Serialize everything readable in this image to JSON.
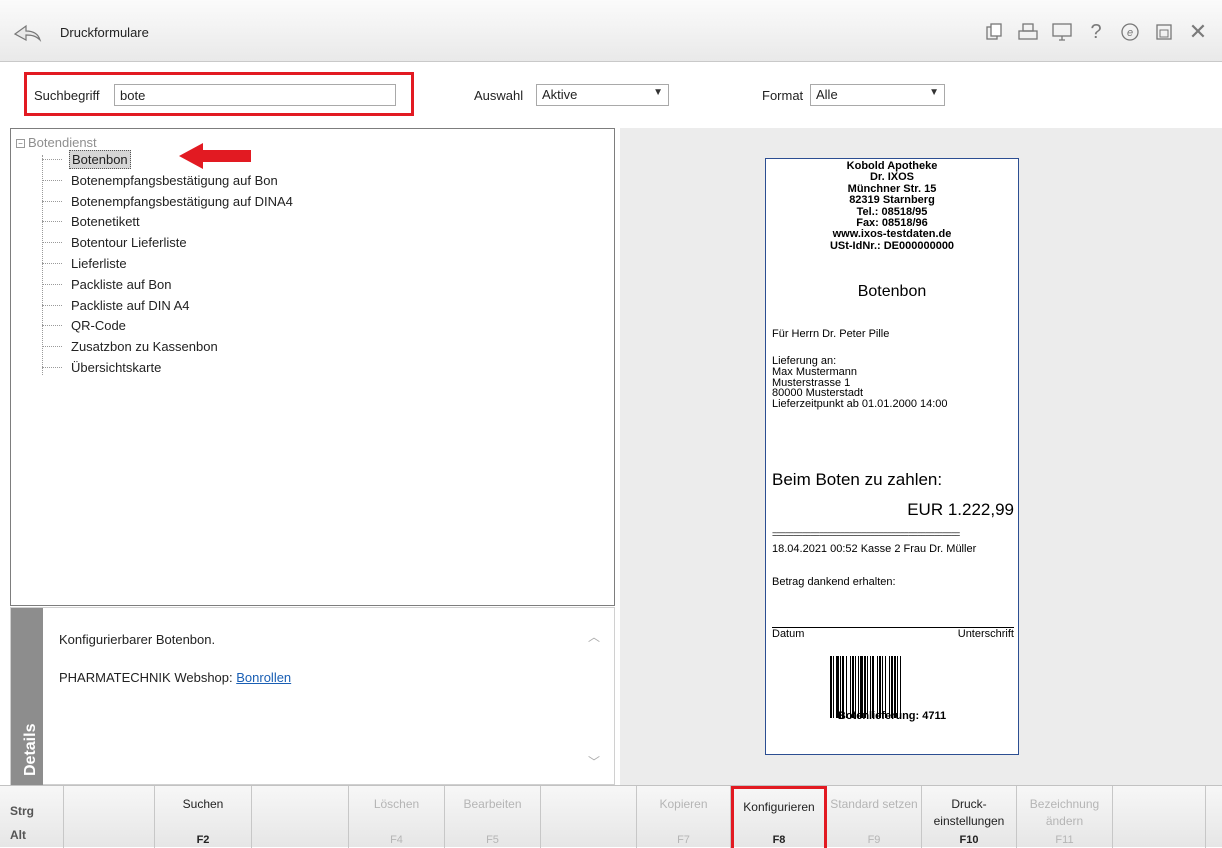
{
  "window": {
    "title": "Druckformulare"
  },
  "search": {
    "label": "Suchbegriff",
    "value": "bote",
    "auswahl_label": "Auswahl",
    "auswahl_value": "Aktive",
    "format_label": "Format",
    "format_value": "Alle"
  },
  "tree": {
    "root": "Botendienst",
    "items": [
      "Botenbon",
      "Botenempfangsbestätigung auf Bon",
      "Botenempfangsbestätigung auf DINA4",
      "Botenetikett",
      "Botentour Lieferliste",
      "Lieferliste",
      "Packliste auf Bon",
      "Packliste auf DIN A4",
      "QR-Code",
      "Zusatzbon zu Kassenbon",
      "Übersichtskarte"
    ],
    "selected_index": 0
  },
  "details": {
    "tab_label": "Details",
    "description": "Konfigurierbarer Botenbon.",
    "webshop_prefix": "PHARMATECHNIK Webshop: ",
    "webshop_link": "Bonrollen"
  },
  "receipt": {
    "header": [
      "Kobold Apotheke",
      "Dr. IXOS",
      "Münchner Str. 15",
      "82319 Starnberg",
      "Tel.: 08518/95",
      "Fax: 08518/96",
      "www.ixos-testdaten.de",
      "USt-IdNr.: DE000000000"
    ],
    "title": "Botenbon",
    "recipient": "Für Herrn Dr. Peter Pille",
    "delivery": [
      "Lieferung an:",
      "Max Mustermann",
      "Musterstrasse 1",
      "80000 Musterstadt",
      "Lieferzeitpunkt ab 01.01.2000 14:00"
    ],
    "pay_label": "Beim Boten zu zahlen:",
    "amount": "EUR 1.222,99",
    "separator": "============================================",
    "transaction": "18.04.2021 00:52 Kasse 2 Frau Dr. Müller",
    "thanks": "Betrag dankend erhalten:",
    "date_label": "Datum",
    "signature_label": "Unterschrift",
    "footer": "Botenlieferung: 4711"
  },
  "fkeys": {
    "mod1": "Strg",
    "mod2": "Alt",
    "keys": [
      {
        "label": "",
        "key": "",
        "enabled": true
      },
      {
        "label": "Suchen",
        "key": "F2",
        "enabled": true
      },
      {
        "label": "",
        "key": "",
        "enabled": true
      },
      {
        "label": "Löschen",
        "key": "F4",
        "enabled": false
      },
      {
        "label": "Bearbeiten",
        "key": "F5",
        "enabled": false
      },
      {
        "label": "",
        "key": "",
        "enabled": true
      },
      {
        "label": "Kopieren",
        "key": "F7",
        "enabled": false
      },
      {
        "label": "Konfigurieren",
        "key": "F8",
        "enabled": true
      },
      {
        "label": "Standard setzen",
        "key": "F9",
        "enabled": false
      },
      {
        "label": "Druck-einstellungen",
        "key": "F10",
        "enabled": true
      },
      {
        "label": "Bezeichnung ändern",
        "key": "F11",
        "enabled": false
      },
      {
        "label": "",
        "key": "",
        "enabled": true
      }
    ]
  },
  "colors": {
    "highlight": "#e21a22",
    "receipt_border": "#2c4e92",
    "link": "#1a5fb4"
  }
}
